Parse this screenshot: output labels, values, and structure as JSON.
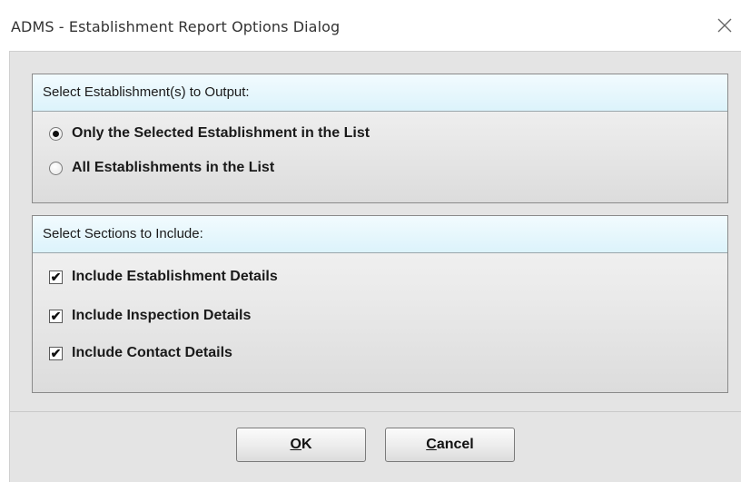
{
  "window": {
    "title": "ADMS - Establishment Report Options Dialog"
  },
  "establishment_group": {
    "header": "Select Establishment(s) to Output:",
    "options": [
      {
        "label": "Only the Selected Establishment in the List",
        "selected": true
      },
      {
        "label": "All Establishments in the List",
        "selected": false
      }
    ]
  },
  "sections_group": {
    "header": "Select Sections to Include:",
    "options": [
      {
        "label": "Include Establishment Details",
        "checked": true
      },
      {
        "label": "Include Inspection Details",
        "checked": true
      },
      {
        "label": "Include Contact Details",
        "checked": true
      }
    ],
    "check_mark": "✔"
  },
  "buttons": {
    "ok_mnemonic": "O",
    "ok_rest": "K",
    "cancel_mnemonic": "C",
    "cancel_rest": "ancel"
  }
}
